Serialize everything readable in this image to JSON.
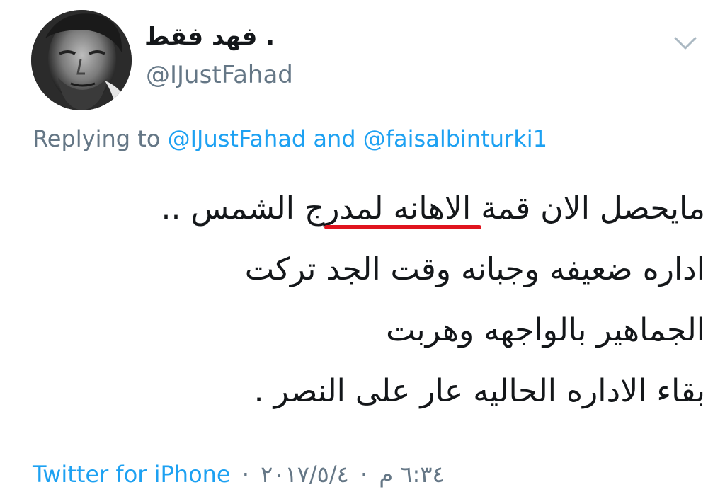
{
  "user": {
    "display_name": "فهد فقط .",
    "handle": "@IJustFahad",
    "avatar_icon": "user-avatar-photo"
  },
  "menu": {
    "icon": "chevron-down-icon"
  },
  "reply": {
    "prefix": "Replying to",
    "mention_1": "@IJustFahad",
    "conjunction": "and",
    "mention_2": "@faisalbinturki1"
  },
  "tweet": {
    "lines": [
      "مايحصل الان قمة الاهانه لمدرج الشمس ..",
      "اداره ضعيفه وجبانه وقت الجد تركت",
      "الجماهير بالواجهه وهربت",
      "بقاء الاداره الحاليه عار على النصر ."
    ],
    "highlight_color": "#e0141e"
  },
  "meta": {
    "source": "Twitter for iPhone",
    "separator": "·",
    "date": "٢٠١٧/٥/٤",
    "time": "٦:٣٤ م"
  },
  "colors": {
    "link": "#1da1f2",
    "secondary": "#657786",
    "text": "#14171a"
  }
}
